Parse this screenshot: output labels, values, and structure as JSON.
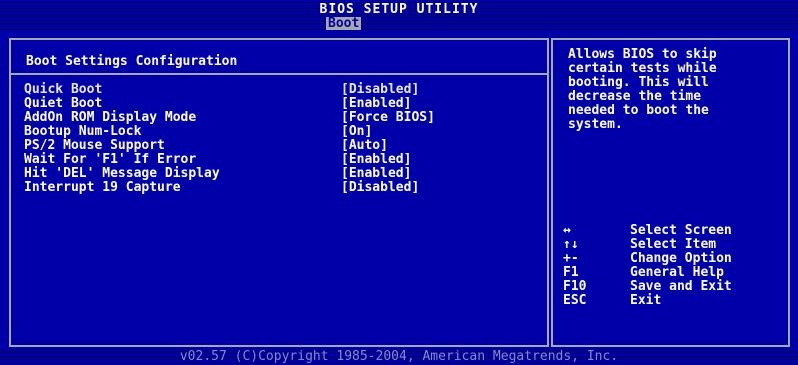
{
  "header": {
    "title": "BIOS SETUP UTILITY",
    "tab": "Boot"
  },
  "main": {
    "heading": "Boot Settings Configuration",
    "items": [
      {
        "label": "Quick Boot",
        "value": "[Disabled]",
        "selected": true
      },
      {
        "label": "Quiet Boot",
        "value": "[Enabled]"
      },
      {
        "label": "AddOn ROM Display Mode",
        "value": "[Force BIOS]"
      },
      {
        "label": "Bootup Num-Lock",
        "value": "[On]"
      },
      {
        "label": "PS/2 Mouse Support",
        "value": "[Auto]"
      },
      {
        "label": "Wait For 'F1' If Error",
        "value": "[Enabled]"
      },
      {
        "label": "Hit 'DEL' Message Display",
        "value": "[Enabled]"
      },
      {
        "label": "Interrupt 19 Capture",
        "value": "[Disabled]"
      }
    ]
  },
  "help": {
    "lines": [
      "Allows BIOS to skip",
      "certain tests while",
      "booting. This will",
      "decrease the time",
      "needed to boot the",
      "system."
    ]
  },
  "keys": [
    {
      "key": "↔",
      "desc": "Select Screen"
    },
    {
      "key": "↑↓",
      "desc": "Select Item"
    },
    {
      "key": "+-",
      "desc": "Change Option"
    },
    {
      "key": "F1",
      "desc": "General Help"
    },
    {
      "key": "F10",
      "desc": "Save and Exit"
    },
    {
      "key": "ESC",
      "desc": "Exit"
    }
  ],
  "footer": {
    "copyright": "v02.57 (C)Copyright 1985-2004, American Megatrends, Inc."
  }
}
